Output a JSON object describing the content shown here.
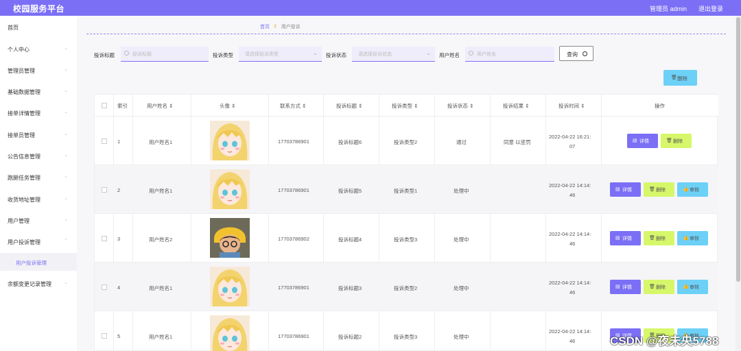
{
  "header": {
    "app_title": "校园服务平台",
    "user": "管理员 admin",
    "logout": "退出登录"
  },
  "sidebar": {
    "items": [
      {
        "label": "首页"
      },
      {
        "label": "个人中心"
      },
      {
        "label": "管理员管理"
      },
      {
        "label": "基础数据管理"
      },
      {
        "label": "接单详情管理"
      },
      {
        "label": "接单员管理"
      },
      {
        "label": "公告信息管理"
      },
      {
        "label": "跑腿任务管理"
      },
      {
        "label": "收货地址管理"
      },
      {
        "label": "用户管理"
      },
      {
        "label": "用户投诉管理"
      },
      {
        "label": "余额变更记录管理"
      }
    ],
    "active_sub": "用户投诉管理"
  },
  "breadcrumb": {
    "home": "首页",
    "current": "用户投诉"
  },
  "filters": {
    "title_label": "投诉标题",
    "title_placeholder": "投诉标题",
    "type_label": "投诉类型",
    "type_placeholder": "请选择投诉类型",
    "status_label": "投诉状态",
    "status_placeholder": "请选择投诉状态",
    "name_label": "用户姓名",
    "name_placeholder": "用户姓名",
    "search_label": "查询"
  },
  "toolbar": {
    "delete_label": "删除"
  },
  "table": {
    "headers": [
      "索引",
      "用户姓名",
      "头像",
      "联系方式",
      "投诉标题",
      "投诉类型",
      "投诉状态",
      "投诉结果",
      "投诉时间",
      "操作"
    ],
    "rows": [
      {
        "index": "1",
        "name": "用户姓名1",
        "phone": "17703786901",
        "title": "投诉标题6",
        "type": "投诉类型2",
        "status": "通过",
        "result": "同意 以惩罚",
        "time1": "2022-04-22 16:21:",
        "time2": "07",
        "avatar": "blonde"
      },
      {
        "index": "2",
        "name": "用户姓名1",
        "phone": "17703786901",
        "title": "投诉标题5",
        "type": "投诉类型1",
        "status": "处理中",
        "result": "",
        "time1": "2022-04-22 14:14:",
        "time2": "46",
        "avatar": "blonde"
      },
      {
        "index": "3",
        "name": "用户姓名2",
        "phone": "17703786902",
        "title": "投诉标题4",
        "type": "投诉类型3",
        "status": "处理中",
        "result": "",
        "time1": "2022-04-22 14:14:",
        "time2": "46",
        "avatar": "boy"
      },
      {
        "index": "4",
        "name": "用户姓名1",
        "phone": "17703786901",
        "title": "投诉标题3",
        "type": "投诉类型2",
        "status": "处理中",
        "result": "",
        "time1": "2022-04-22 14:14:",
        "time2": "46",
        "avatar": "blonde"
      },
      {
        "index": "5",
        "name": "用户姓名1",
        "phone": "17703786901",
        "title": "投诉标题2",
        "type": "投诉类型3",
        "status": "处理中",
        "result": "",
        "time1": "2022-04-22 14:14:",
        "time2": "46",
        "avatar": "blonde"
      }
    ],
    "actions": {
      "detail": "详情",
      "delete": "删除",
      "audit": "审核"
    }
  },
  "watermark": "CSDN @夜未央5788",
  "colors": {
    "accent": "#7b6ff5",
    "lime": "#d6f76a",
    "cyan": "#6cd0f7"
  }
}
